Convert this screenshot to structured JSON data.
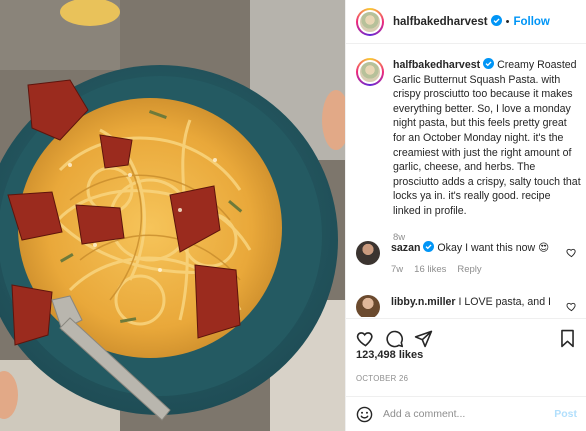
{
  "header": {
    "username": "halfbakedharvest",
    "separator": "•",
    "follow_label": "Follow"
  },
  "caption": {
    "username": "halfbakedharvest",
    "text": "Creamy Roasted Garlic Butternut Squash Pasta. with crispy prosciutto too because it makes everything better. So, I love a monday night pasta, but this feels pretty great for an October Monday night. it's the creamiest with just the right amount of garlic, cheese, and herbs. The prosciutto adds a crispy, salty touch that locks ya in. it's really good. recipe linked in profile.",
    "age": "8w"
  },
  "comments": [
    {
      "username": "sazan",
      "text": "Okay I want this now 😍",
      "age": "7w",
      "likes": "16 likes",
      "reply": "Reply"
    },
    {
      "username": "libby.n.miller",
      "text": "I LOVE pasta, and I"
    }
  ],
  "actions": {
    "likes": "123,498 likes",
    "date": "OCTOBER 26"
  },
  "add_comment": {
    "placeholder": "Add a comment...",
    "post_label": "Post"
  },
  "icons": {
    "verified": "verified-badge-icon",
    "like": "heart-icon",
    "comment": "comment-bubble-icon",
    "share": "paper-plane-icon",
    "save": "bookmark-icon",
    "emoji": "smiley-icon"
  },
  "colors": {
    "accent": "#0095f6",
    "post_disabled": "#b2dffc",
    "muted": "#8e8e8e",
    "text": "#262626"
  }
}
